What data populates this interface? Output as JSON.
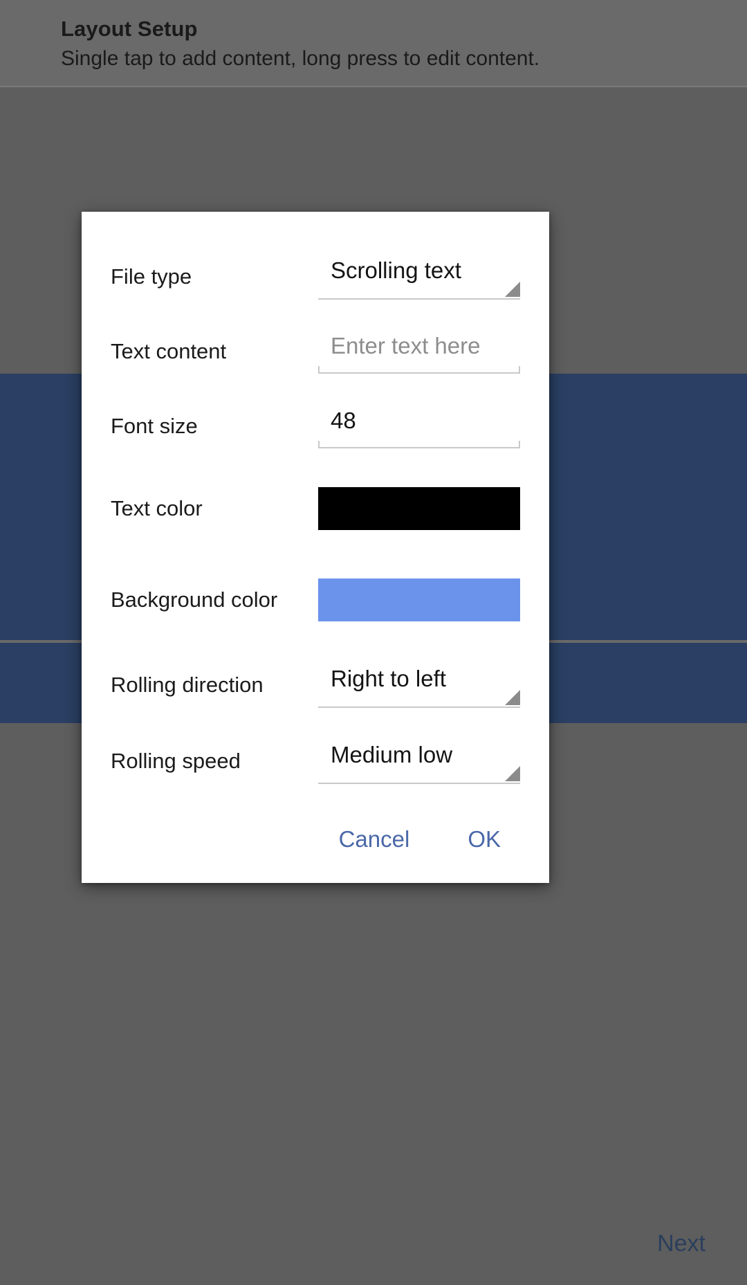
{
  "screen": {
    "header": {
      "title": "Layout Setup",
      "subtitle": "Single tap to add content, long press to edit content."
    },
    "next_label": "Next",
    "panel_color": "#2a3f63",
    "scrim_color": "#5e5e5e"
  },
  "dialog": {
    "rows": [
      {
        "label": "File type",
        "type": "spinner",
        "value": "Scrolling text"
      },
      {
        "label": "Text content",
        "type": "textfield",
        "value": "",
        "placeholder": "Enter text here"
      },
      {
        "label": "Font size",
        "type": "textfield",
        "value": "48",
        "placeholder": ""
      },
      {
        "label": "Text color",
        "type": "swatch",
        "value": "#000000"
      },
      {
        "label": "Background color",
        "type": "swatch",
        "value": "#6b93ec"
      },
      {
        "label": "Rolling direction",
        "type": "spinner",
        "value": "Right to left"
      },
      {
        "label": "Rolling speed",
        "type": "spinner",
        "value": "Medium low"
      }
    ],
    "actions": {
      "cancel_label": "Cancel",
      "ok_label": "OK",
      "accent_color": "#4a68a8"
    }
  }
}
